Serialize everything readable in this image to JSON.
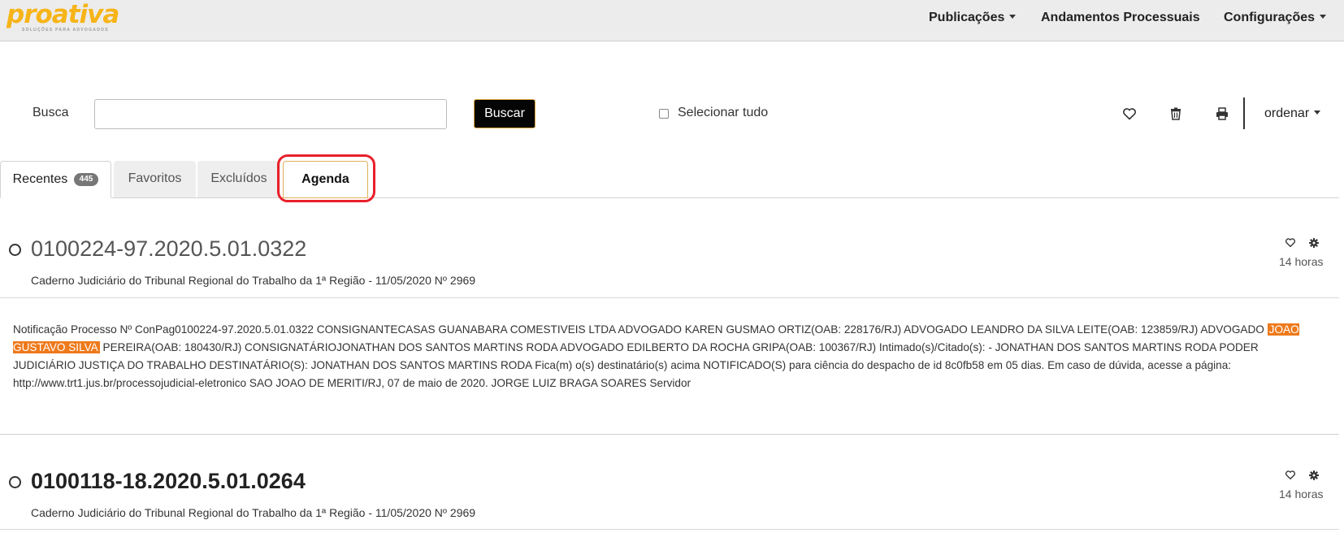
{
  "logo": {
    "text": "proativa",
    "tagline": "SOLUÇÕES PARA ADVOGADOS"
  },
  "nav": {
    "publicacoes": "Publicações",
    "andamentos": "Andamentos Processuais",
    "configuracoes": "Configurações"
  },
  "search": {
    "label": "Busca",
    "value": "",
    "button": "Buscar",
    "select_all": "Selecionar tudo",
    "sort": "ordenar"
  },
  "tabs": {
    "recentes": "Recentes",
    "recentes_count": "445",
    "favoritos": "Favoritos",
    "excluidos": "Excluídos",
    "agenda": "Agenda"
  },
  "colors": {
    "accent": "#f7b418",
    "highlight": "#ee7a1c",
    "annotation_ring": "#e8202a"
  },
  "results": [
    {
      "number": "0100224-97.2020.5.01.0322",
      "source": "Caderno Judiciário do Tribunal Regional do Trabalho da 1ª Região - 11/05/2020 Nº 2969",
      "time": "14 horas",
      "body_before": "Notificação Processo Nº ConPag0100224-97.2020.5.01.0322 CONSIGNANTECASAS GUANABARA COMESTIVEIS LTDA ADVOGADO KAREN GUSMAO ORTIZ(OAB: 228176/RJ) ADVOGADO LEANDRO DA SILVA LEITE(OAB: 123859/RJ) ADVOGADO ",
      "body_highlight": "JOAO GUSTAVO SILVA",
      "body_after": " PEREIRA(OAB: 180430/RJ) CONSIGNATÁRIOJONATHAN DOS SANTOS MARTINS RODA ADVOGADO EDILBERTO DA ROCHA GRIPA(OAB: 100367/RJ) Intimado(s)/Citado(s): - JONATHAN DOS SANTOS MARTINS RODA PODER JUDICIÁRIO JUSTIÇA DO TRABALHO DESTINATÁRIO(S): JONATHAN DOS SANTOS MARTINS RODA Fica(m) o(s) destinatário(s) acima NOTIFICADO(S) para ciência do despacho de id 8c0fb58 em 05 dias. Em caso de dúvida, acesse a página: http://www.trt1.jus.br/processojudicial-eletronico SAO JOAO DE MERITI/RJ, 07 de maio de 2020. JORGE LUIZ BRAGA SOARES Servidor"
    },
    {
      "number": "0100118-18.2020.5.01.0264",
      "source": "Caderno Judiciário do Tribunal Regional do Trabalho da 1ª Região - 11/05/2020 Nº 2969",
      "time": "14 horas"
    }
  ]
}
